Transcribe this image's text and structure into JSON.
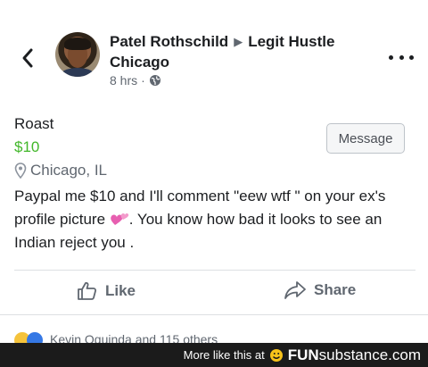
{
  "post": {
    "author": "Patel Rothschild",
    "group": "Legit Hustle Chicago",
    "time": "8 hrs",
    "separator": "·"
  },
  "listing": {
    "title": "Roast",
    "price": "$10",
    "location": "Chicago, IL",
    "message_label": "Message",
    "description_part1": "Paypal me $10 and I'll comment  \"eew wtf \" on your ex's profile picture",
    "description_part2": ". You know how bad it looks to see an Indian reject you ."
  },
  "actions": {
    "like_label": "Like",
    "share_label": "Share"
  },
  "reactions": {
    "text": "Kevin Oquinda and 115 others"
  },
  "watermark": {
    "prefix": "More like this at",
    "brand_bold": "FUN",
    "brand_rest": "substance.com"
  },
  "colors": {
    "price": "#42b72a",
    "heart_emoji": "#e75fb0"
  },
  "icons": {
    "back": "chevron-left-icon",
    "more": "ellipsis-icon",
    "privacy": "globe-icon",
    "location": "location-pin-icon",
    "like": "thumbs-up-icon",
    "share": "share-arrow-icon",
    "heart": "two-hearts-emoji"
  }
}
